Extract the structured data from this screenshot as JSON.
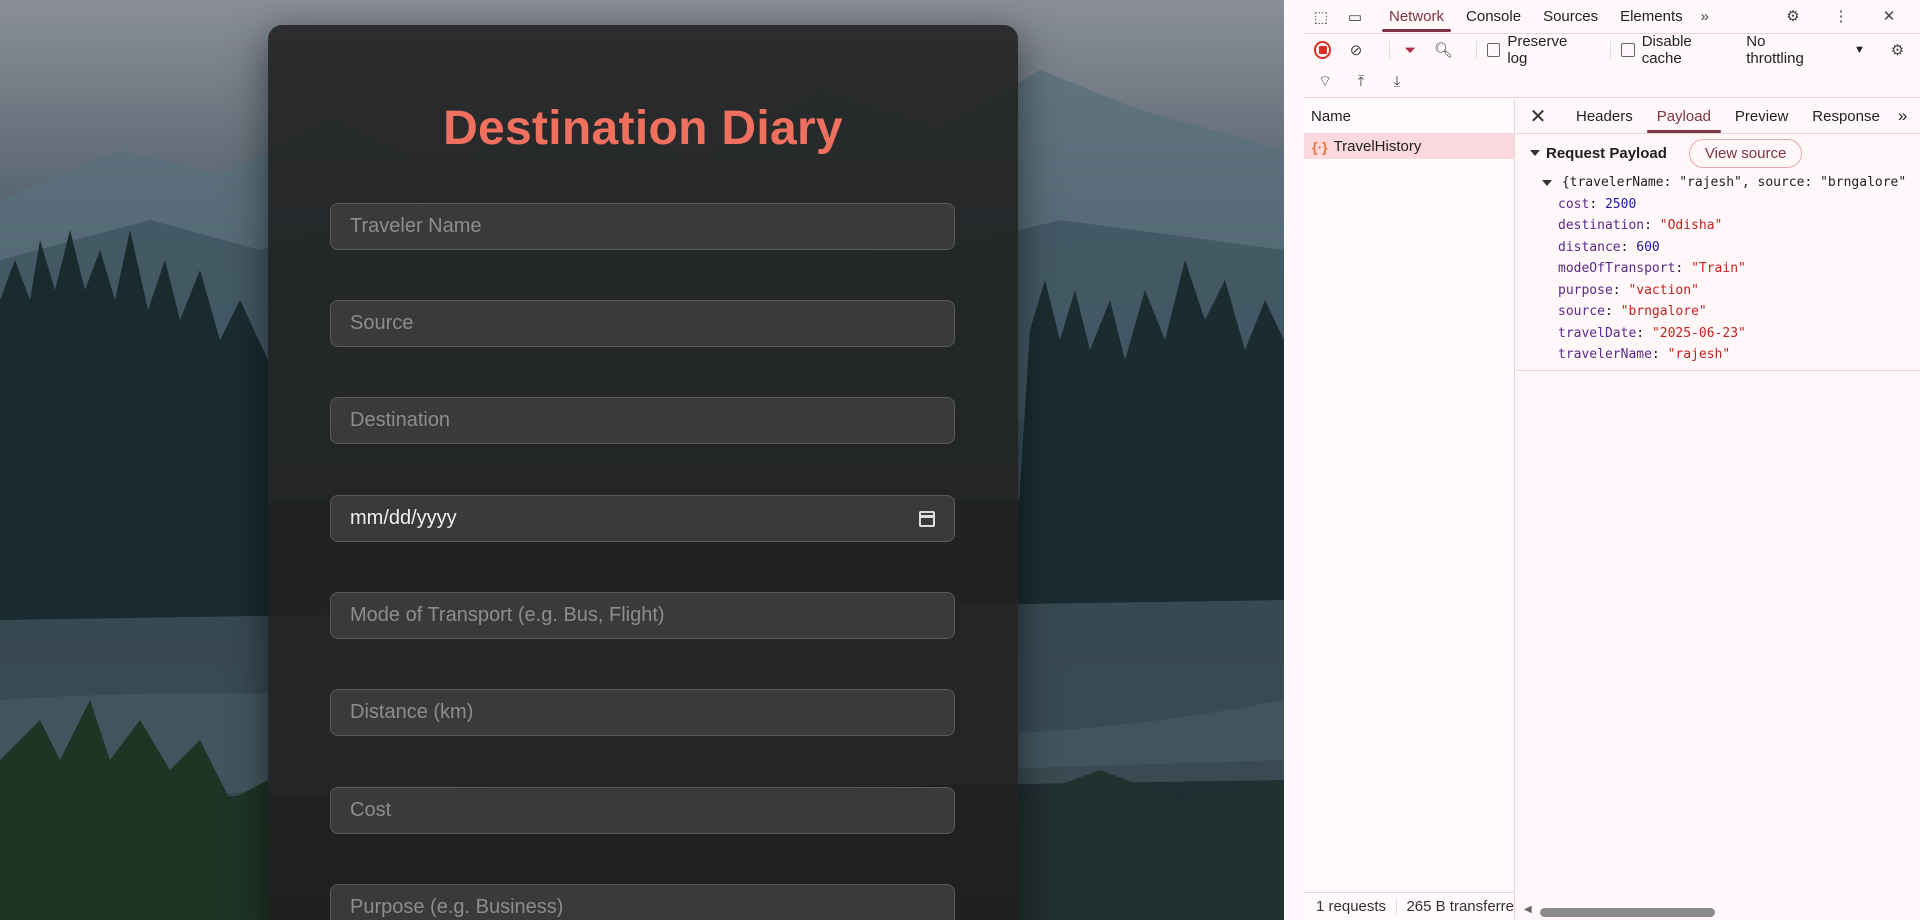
{
  "form": {
    "title": "Destination Diary",
    "fields": [
      {
        "placeholder": "Traveler Name"
      },
      {
        "placeholder": "Source"
      },
      {
        "placeholder": "Destination"
      },
      {
        "value": "mm/dd/yyyy"
      },
      {
        "placeholder": "Mode of Transport (e.g. Bus, Flight)"
      },
      {
        "placeholder": "Distance (km)"
      },
      {
        "placeholder": "Cost"
      },
      {
        "placeholder": "Purpose (e.g. Business)"
      }
    ]
  },
  "devtools": {
    "tabs": [
      "Network",
      "Console",
      "Sources",
      "Elements"
    ],
    "active_tab": "Network",
    "toolbar": {
      "preserve_log": "Preserve log",
      "disable_cache": "Disable cache",
      "throttling": "No throttling"
    },
    "name_header": "Name",
    "request": "TravelHistory",
    "status": {
      "requests": "1 requests",
      "transferred": "265 B transferre"
    },
    "detail_tabs": [
      "Headers",
      "Payload",
      "Preview",
      "Response"
    ],
    "active_detail_tab": "Payload",
    "payload_title": "Request Payload",
    "view_source": "View source",
    "summary": "{travelerName: \"rajesh\", source: \"brngalore\"",
    "entries": [
      {
        "key": "cost",
        "value": "2500",
        "type": "num"
      },
      {
        "key": "destination",
        "value": "\"Odisha\"",
        "type": "str"
      },
      {
        "key": "distance",
        "value": "600",
        "type": "num"
      },
      {
        "key": "modeOfTransport",
        "value": "\"Train\"",
        "type": "str"
      },
      {
        "key": "purpose",
        "value": "\"vaction\"",
        "type": "str"
      },
      {
        "key": "source",
        "value": "\"brngalore\"",
        "type": "str"
      },
      {
        "key": "travelDate",
        "value": "\"2025-06-23\"",
        "type": "str"
      },
      {
        "key": "travelerName",
        "value": "\"rajesh\"",
        "type": "str"
      }
    ]
  }
}
